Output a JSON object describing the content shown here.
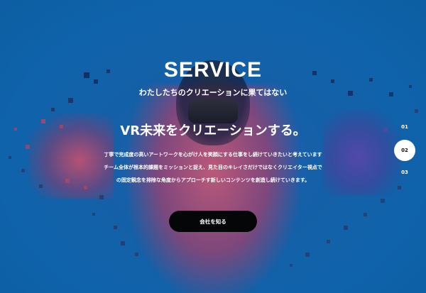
{
  "hero": {
    "title": "SERVICE",
    "subtitle": "わたしたちのクリエーションに果てはない",
    "headline": "VR未来をクリエーションする。",
    "paragraph": {
      "line1": "丁寧で完成度の高いアートワークを心がけ人を笑顔にする仕事をし続けていきたいと考えています",
      "line2": "チーム全体が根本的課題をミッションと捉え、見た目のキレイさだけではなくクリエイター視点で",
      "line3": "の固定観念を排除な角度からアプローチす新しいコンテンツを創造し続けていきます。"
    },
    "cta_label": "会社を知る"
  },
  "pager": {
    "items": [
      "01",
      "02",
      "03"
    ],
    "active_index": 1
  },
  "colors": {
    "background": "#0f63aa",
    "cta_bg": "#050607",
    "text": "#ffffff"
  }
}
